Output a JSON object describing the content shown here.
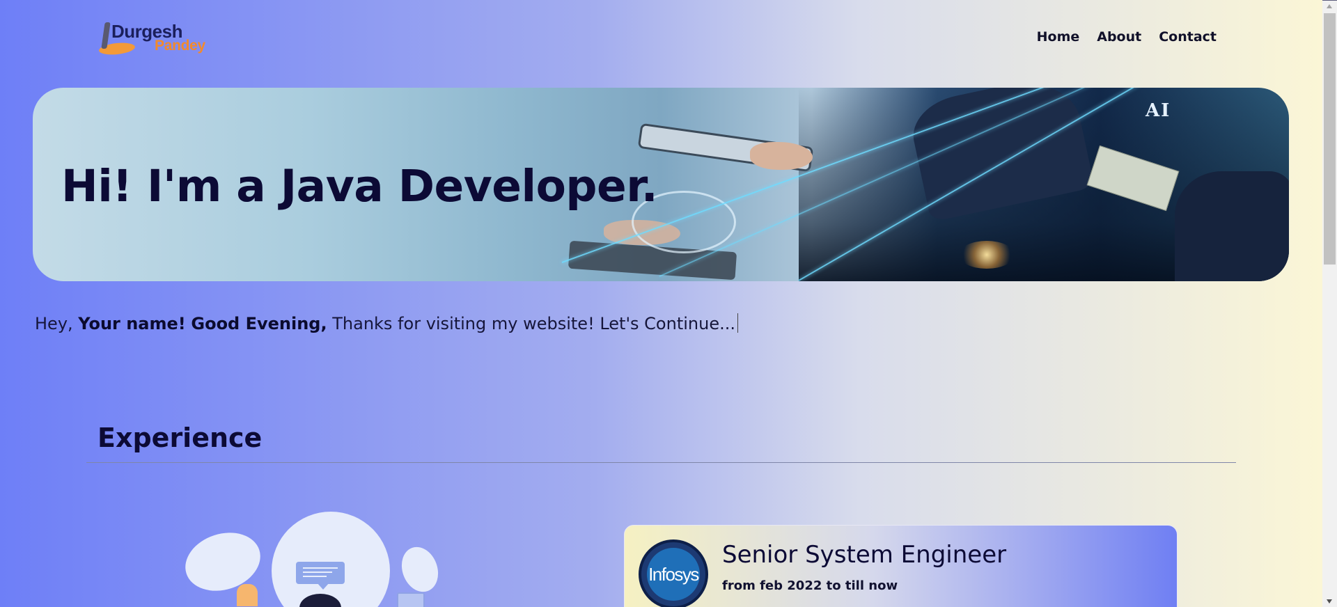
{
  "header": {
    "logo": {
      "line1": "Durgesh",
      "line2": "Pandey"
    },
    "nav": [
      {
        "label": "Home"
      },
      {
        "label": "About"
      },
      {
        "label": "Contact"
      }
    ]
  },
  "hero": {
    "title": "Hi! I'm a Java Developer.",
    "image_text": "AI"
  },
  "greeting": {
    "prefix": "Hey, ",
    "name": "Your name!",
    "salutation": "Good Evening,",
    "message": " Thanks for visiting my website! Let's Continue..."
  },
  "experience": {
    "title": "Experience",
    "items": [
      {
        "company_logo_text": "Infosys",
        "role": "Senior System Engineer",
        "period": "from feb 2022 to till now"
      }
    ]
  },
  "colors": {
    "background_left": "#6e7ff7",
    "background_right": "#fbf6d6",
    "heading": "#0c0a35",
    "logo_orange": "#f28a2c",
    "logo_navy": "#1b1f5c"
  }
}
